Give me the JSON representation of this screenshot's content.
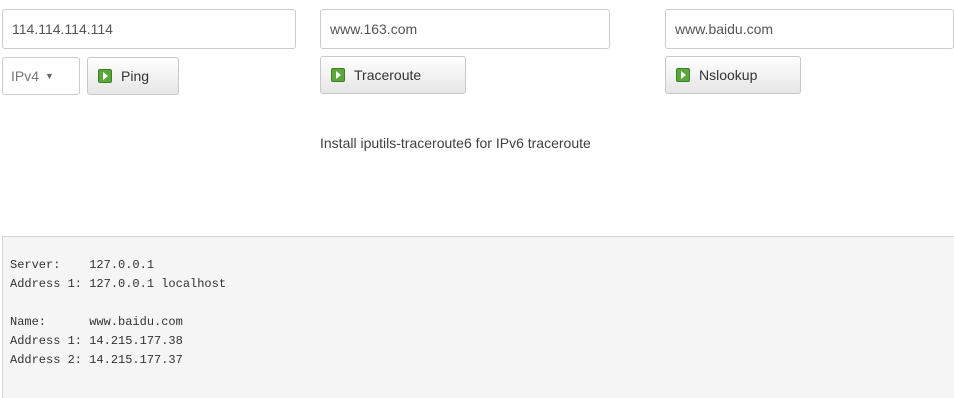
{
  "ping": {
    "host_value": "114.114.114.114",
    "protocol_selected": "IPv4",
    "button_label": "Ping"
  },
  "traceroute": {
    "host_value": "www.163.com",
    "button_label": "Traceroute",
    "note": "Install iputils-traceroute6 for IPv6 traceroute"
  },
  "nslookup": {
    "host_value": "www.baidu.com",
    "button_label": "Nslookup"
  },
  "output": {
    "server": "Server:    127.0.0.1",
    "server_address": "Address 1: 127.0.0.1 localhost",
    "name": "Name:      www.baidu.com",
    "address_1": "Address 1: 14.215.177.38",
    "address_2": "Address 2: 14.215.177.37"
  },
  "colors": {
    "button_icon": "#5aa83a",
    "output_background": "#f5f5f5"
  }
}
